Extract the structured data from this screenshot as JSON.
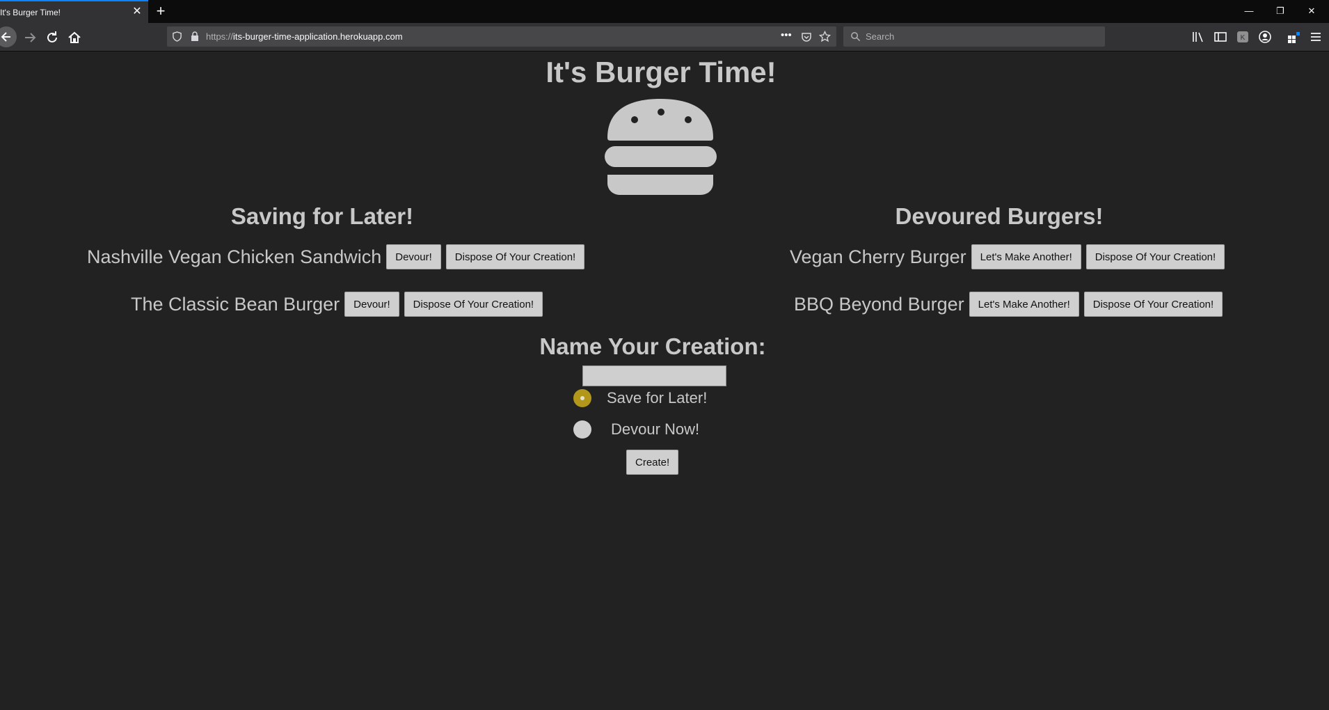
{
  "browser": {
    "tab_title": "It's Burger Time!",
    "url_prefix": "https://",
    "url_host": "its-burger-time-application.herokuapp.com",
    "search_placeholder": "Search"
  },
  "page": {
    "title": "It's Burger Time!",
    "saved_heading": "Saving for Later!",
    "devoured_heading": "Devoured Burgers!",
    "saved": [
      {
        "name": "Nashville Vegan Chicken Sandwich",
        "devour_label": "Devour!",
        "dispose_label": "Dispose Of Your Creation!"
      },
      {
        "name": "The Classic Bean Burger",
        "devour_label": "Devour!",
        "dispose_label": "Dispose Of Your Creation!"
      }
    ],
    "devoured": [
      {
        "name": "Vegan Cherry Burger",
        "again_label": "Let's Make Another!",
        "dispose_label": "Dispose Of Your Creation!"
      },
      {
        "name": "BBQ Beyond Burger",
        "again_label": "Let's Make Another!",
        "dispose_label": "Dispose Of Your Creation!"
      }
    ],
    "form": {
      "heading": "Name Your Creation:",
      "name_value": "",
      "option_save": "Save for Later!",
      "option_devour": "Devour Now!",
      "selected": "Save for Later!",
      "create_label": "Create!"
    }
  },
  "colors": {
    "background": "#222222",
    "text": "#c8c8c8",
    "radio_selected": "#b3971b",
    "button": "#cfcfcf"
  }
}
